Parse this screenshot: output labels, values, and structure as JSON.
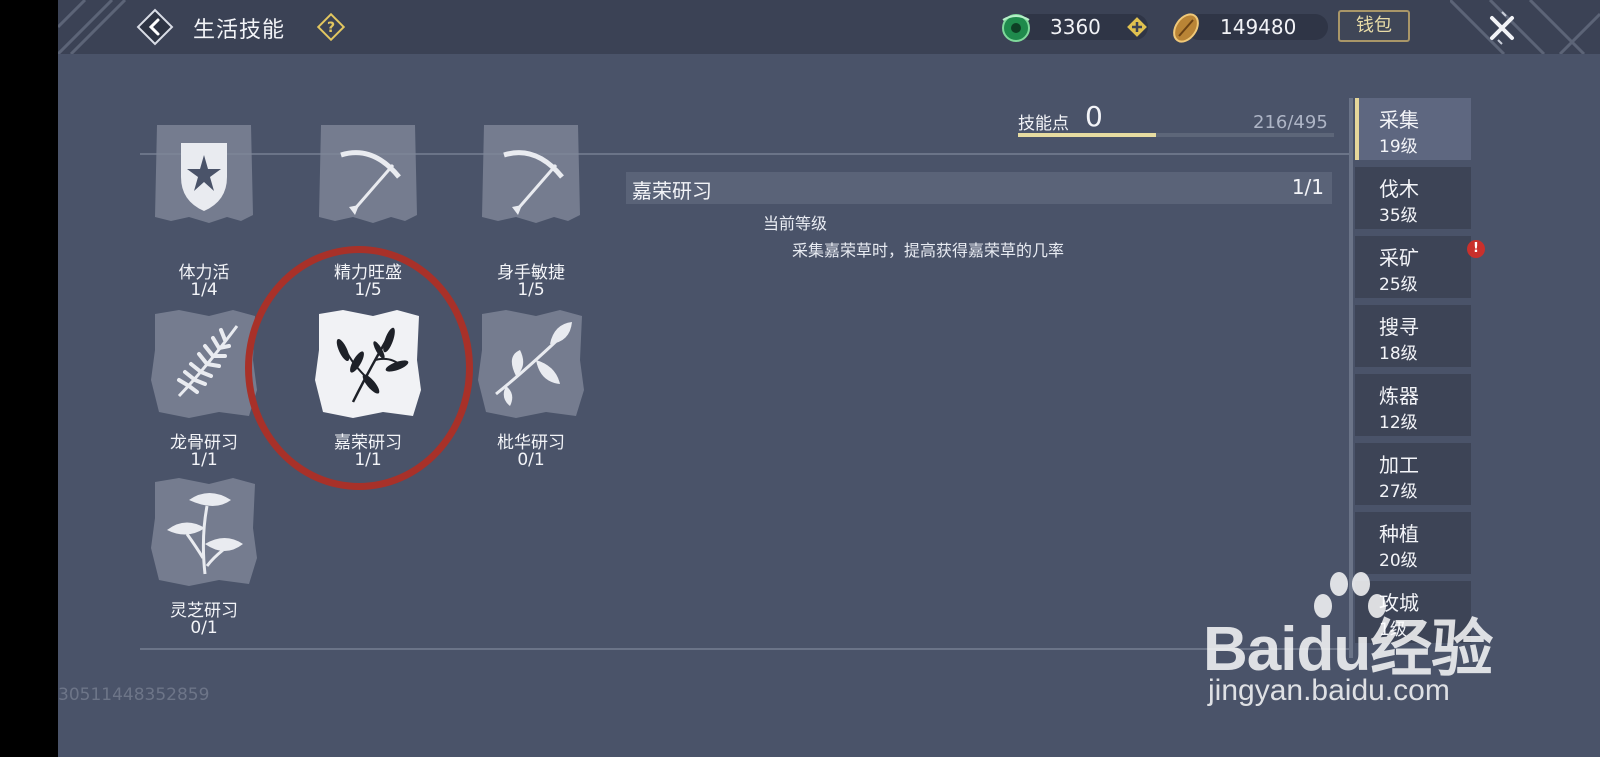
{
  "header": {
    "title": "生活技能",
    "back_icon": "back-arrow-icon",
    "help_icon": "question-diamond-icon",
    "currencies": [
      {
        "name": "jade",
        "icon": "jade-coin-icon",
        "value": "3360"
      },
      {
        "name": "coin",
        "icon": "copper-coin-icon",
        "value": "149480"
      }
    ],
    "wallet_label": "钱包",
    "close_icon": "close-x-icon"
  },
  "skill_points": {
    "label": "技能点",
    "value": "0",
    "progress_text": "216/495",
    "progress_fraction": 0.436
  },
  "skills": [
    {
      "name": "体力活",
      "level": "1/4",
      "icon": "shield-star-icon"
    },
    {
      "name": "精力旺盛",
      "level": "1/5",
      "icon": "bow-arrow-icon"
    },
    {
      "name": "身手敏捷",
      "level": "1/5",
      "icon": "bow-arrow-icon"
    },
    {
      "name": "龙骨研习",
      "level": "1/1",
      "icon": "fern-leaf-icon"
    },
    {
      "name": "嘉荣研习",
      "level": "1/1",
      "icon": "herb-branch-icon",
      "selected": true
    },
    {
      "name": "枇华研习",
      "level": "0/1",
      "icon": "leafy-branch-icon"
    },
    {
      "name": "灵芝研习",
      "level": "0/1",
      "icon": "lingzhi-mushroom-icon"
    }
  ],
  "detail": {
    "name": "嘉荣研习",
    "count": "1/1",
    "level_label": "当前等级",
    "description": "采集嘉荣草时，提高获得嘉荣草的几率"
  },
  "tabs": [
    {
      "name": "采集",
      "level": "19级",
      "active": true
    },
    {
      "name": "伐木",
      "level": "35级"
    },
    {
      "name": "采矿",
      "level": "25级",
      "alert": "!"
    },
    {
      "name": "搜寻",
      "level": "18级"
    },
    {
      "name": "炼器",
      "level": "12级"
    },
    {
      "name": "加工",
      "level": "27级"
    },
    {
      "name": "种植",
      "level": "20级"
    },
    {
      "name": "攻城",
      "level": "1级"
    }
  ],
  "build_code": "30511448352859",
  "watermark": {
    "logo": "Baidu经验",
    "url": "jingyan.baidu.com"
  },
  "colors": {
    "background": "#4a5369",
    "topbar": "#3b4255",
    "highlight_circle": "#a83129",
    "accent_gold": "#e6d79a",
    "alert_red": "#c9302c"
  }
}
